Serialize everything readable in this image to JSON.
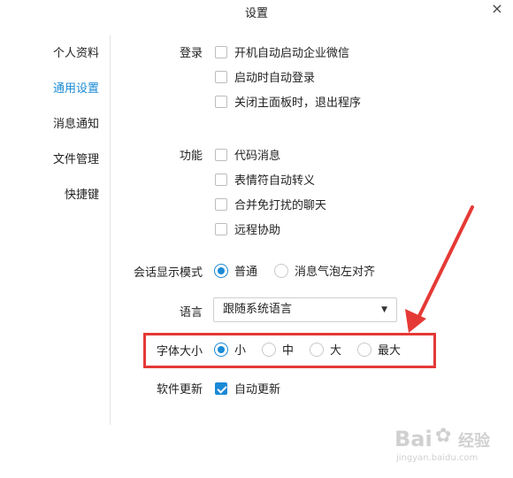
{
  "window": {
    "title": "设置",
    "close_icon": "×"
  },
  "sidebar": {
    "items": [
      {
        "label": "个人资料",
        "active": false
      },
      {
        "label": "通用设置",
        "active": true
      },
      {
        "label": "消息通知",
        "active": false
      },
      {
        "label": "文件管理",
        "active": false
      },
      {
        "label": "快捷键",
        "active": false
      }
    ]
  },
  "login": {
    "label": "登录",
    "options": [
      {
        "label": "开机自动启动企业微信",
        "checked": false
      },
      {
        "label": "启动时自动登录",
        "checked": false
      },
      {
        "label": "关闭主面板时，退出程序",
        "checked": false
      }
    ]
  },
  "features": {
    "label": "功能",
    "options": [
      {
        "label": "代码消息",
        "checked": false
      },
      {
        "label": "表情符自动转义",
        "checked": false
      },
      {
        "label": "合并免打扰的聊天",
        "checked": false
      },
      {
        "label": "远程协助",
        "checked": false
      }
    ]
  },
  "conversation_mode": {
    "label": "会话显示模式",
    "options": [
      {
        "label": "普通",
        "selected": true
      },
      {
        "label": "消息气泡左对齐",
        "selected": false
      }
    ]
  },
  "language": {
    "label": "语言",
    "value": "跟随系统语言",
    "arrow_icon": "▼"
  },
  "font_size": {
    "label": "字体大小",
    "options": [
      {
        "label": "小",
        "selected": true
      },
      {
        "label": "中",
        "selected": false
      },
      {
        "label": "大",
        "selected": false
      },
      {
        "label": "最大",
        "selected": false
      }
    ]
  },
  "software_update": {
    "label": "软件更新",
    "option": {
      "label": "自动更新",
      "checked": true
    }
  },
  "colors": {
    "accent": "#1a8ad6",
    "annotation_red": "#e53935"
  },
  "watermark": {
    "text": "Bai",
    "sub": "jingyan.baidu.com",
    "suffix": "经验"
  }
}
